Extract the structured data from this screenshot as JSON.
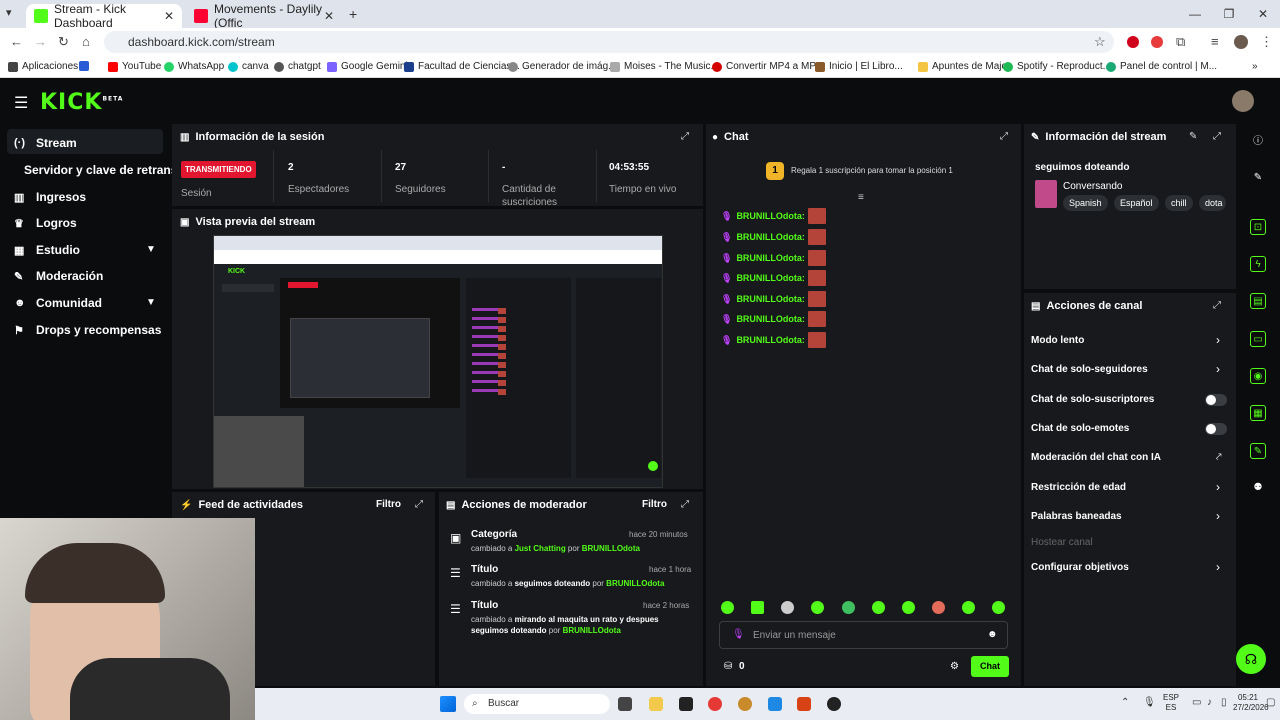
{
  "browser": {
    "tabs": [
      {
        "label": "Stream - Kick Dashboard",
        "active": true
      },
      {
        "label": "Movements - Daylily (Offic",
        "active": false
      }
    ],
    "url": "dashboard.kick.com/stream",
    "bookmarks": [
      "Aplicaciones",
      "YouTube",
      "WhatsApp",
      "canva",
      "chatgpt",
      "Google Gemini",
      "Facultad de Ciencias...",
      "Generador de imág...",
      "Moises - The Music...",
      "Convertir MP4 a MP...",
      "Inicio | El Libro...",
      "Apuntes de Majo",
      "Spotify - Reproduct...",
      "Panel de control | M..."
    ]
  },
  "sidebar": {
    "items": [
      {
        "label": "Stream",
        "icon": "radio-icon"
      },
      {
        "label": "Servidor y clave de retransmisión",
        "icon": ""
      },
      {
        "label": "Ingresos",
        "icon": "chart-icon"
      },
      {
        "label": "Logros",
        "icon": "trophy-icon"
      },
      {
        "label": "Estudio",
        "icon": "grid-icon"
      },
      {
        "label": "Moderación",
        "icon": "wrench-icon"
      },
      {
        "label": "Comunidad",
        "icon": "users-icon"
      },
      {
        "label": "Drops y recompensas",
        "icon": "gift-icon"
      }
    ]
  },
  "session": {
    "title": "Información de la sesión",
    "badge": "TRANSMITIENDO",
    "badge_label": "Sesión",
    "stats": [
      {
        "value": "2",
        "label": "Espectadores"
      },
      {
        "value": "27",
        "label": "Seguidores"
      },
      {
        "value": "-",
        "label": "Cantidad de suscriciones"
      },
      {
        "value": "04:53:55",
        "label": "Tiempo en vivo"
      }
    ]
  },
  "preview": {
    "title": "Vista previa del stream"
  },
  "feed": {
    "title": "Feed de actividades",
    "filter": "Filtro"
  },
  "mod_actions": {
    "title": "Acciones de moderador",
    "filter": "Filtro",
    "items": [
      {
        "title": "Categoría",
        "time": "hace 20 minutos",
        "pre": "cambiado a ",
        "value": "Just Chatting",
        "mid": " por ",
        "user": "BRUNILLOdota"
      },
      {
        "title": "Título",
        "time": "hace 1 hora",
        "pre": "cambiado a ",
        "value": "seguimos doteando",
        "mid": " por ",
        "user": "BRUNILLOdota"
      },
      {
        "title": "Título",
        "time": "hace 2 horas",
        "pre": "cambiado a ",
        "value": "mirando al maquita un rato y despues seguimos doteando",
        "mid": " por ",
        "user": "BRUNILLOdota"
      }
    ]
  },
  "chat": {
    "title": "Chat",
    "gift_banner": "Regala 1 suscripción para tomar la posición 1",
    "gift_rank": "1",
    "messages": [
      "BRUNILLOdota:",
      "BRUNILLOdota:",
      "BRUNILLOdota:",
      "BRUNILLOdota:",
      "BRUNILLOdota:",
      "BRUNILLOdota:",
      "BRUNILLOdota:"
    ],
    "input_placeholder": "Enviar un mensaje",
    "points": "0",
    "send_label": "Chat"
  },
  "stream_info": {
    "title": "Información del stream",
    "stream_title": "seguimos doteando",
    "category": "Conversando",
    "tags": [
      "Spanish",
      "Español",
      "chill",
      "dota"
    ]
  },
  "channel_actions": {
    "title": "Acciones de canal",
    "items": [
      {
        "label": "Modo lento",
        "control": "arrow"
      },
      {
        "label": "Chat de solo-seguidores",
        "control": "arrow"
      },
      {
        "label": "Chat de solo-suscriptores",
        "control": "toggle"
      },
      {
        "label": "Chat de solo-emotes",
        "control": "toggle"
      },
      {
        "label": "Moderación del chat con IA",
        "control": "external"
      },
      {
        "label": "Restricción de edad",
        "control": "arrow"
      },
      {
        "label": "Palabras baneadas",
        "control": "arrow"
      },
      {
        "label": "Hostear canal",
        "control": "disabled"
      },
      {
        "label": "Configurar objetivos",
        "control": "arrow"
      }
    ]
  },
  "taskbar": {
    "search": "Buscar",
    "lang": "ESP",
    "lang2": "ES",
    "time": "05:21",
    "date": "27/2/2026"
  },
  "colors": {
    "accent": "#53fc18",
    "live": "#e2162e",
    "panel": "#17191c",
    "bg": "#0b0c0e"
  }
}
